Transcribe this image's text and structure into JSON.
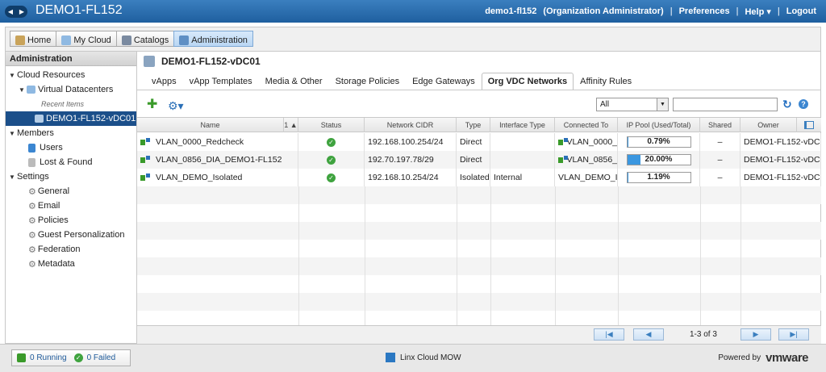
{
  "topbar": {
    "title": "DEMO1-FL152",
    "user": "demo1-fl152",
    "role": "(Organization Administrator)",
    "preferences": "Preferences",
    "help": "Help ▾",
    "logout": "Logout",
    "separator": "|"
  },
  "main_tabs": [
    {
      "label": "Home",
      "icon": "home-icon"
    },
    {
      "label": "My Cloud",
      "icon": "cloud-icon"
    },
    {
      "label": "Catalogs",
      "icon": "catalog-icon"
    },
    {
      "label": "Administration",
      "icon": "admin-icon",
      "active": true
    }
  ],
  "left": {
    "header": "Administration",
    "cloud_resources": "Cloud Resources",
    "virtual_datacenters": "Virtual Datacenters",
    "recent_items": "Recent Items",
    "selected_vdc": "DEMO1-FL152-vDC01",
    "members": "Members",
    "users": "Users",
    "lost_found": "Lost & Found",
    "settings": "Settings",
    "general": "General",
    "email": "Email",
    "policies": "Policies",
    "guest_personalization": "Guest Personalization",
    "federation": "Federation",
    "metadata": "Metadata"
  },
  "right": {
    "title": "DEMO1-FL152-vDC01",
    "subtabs": [
      "vApps",
      "vApp Templates",
      "Media & Other",
      "Storage Policies",
      "Edge Gateways",
      "Org VDC Networks",
      "Affinity Rules"
    ],
    "active_subtab": 5,
    "filter_value": "All",
    "filter_placeholder": ""
  },
  "grid": {
    "headers": [
      "Name",
      "1 ▲",
      "Status",
      "Network CIDR",
      "Type",
      "Interface Type",
      "Connected To",
      "IP Pool (Used/Total)",
      "Shared",
      "Owner"
    ],
    "rows": [
      {
        "name": "VLAN_0000_Redcheck",
        "status": "ok",
        "cidr": "192.168.100.254/24",
        "type": "Direct",
        "interface": "",
        "connected": "VLAN_0000_",
        "pool_label": "0.79%",
        "pool_fraction": 0.0079,
        "shared": "–",
        "owner": "DEMO1-FL152-vDC"
      },
      {
        "name": "VLAN_0856_DIA_DEMO1-FL152",
        "status": "ok",
        "cidr": "192.70.197.78/29",
        "type": "Direct",
        "interface": "",
        "connected": "VLAN_0856_",
        "pool_label": "20.00%",
        "pool_fraction": 0.2,
        "shared": "–",
        "owner": "DEMO1-FL152-vDC"
      },
      {
        "name": "VLAN_DEMO_Isolated",
        "status": "ok",
        "cidr": "192.168.10.254/24",
        "type": "Isolated",
        "interface": "Internal",
        "connected": "VLAN_DEMO_Is",
        "pool_label": "1.19%",
        "pool_fraction": 0.0119,
        "shared": "–",
        "owner": "DEMO1-FL152-vDC"
      }
    ],
    "pager_info": "1-3 of 3"
  },
  "status": {
    "running": "0 Running",
    "failed": "0 Failed",
    "brand": "Linx Cloud MOW",
    "powered_by": "Powered by",
    "vendor": "vmware"
  }
}
